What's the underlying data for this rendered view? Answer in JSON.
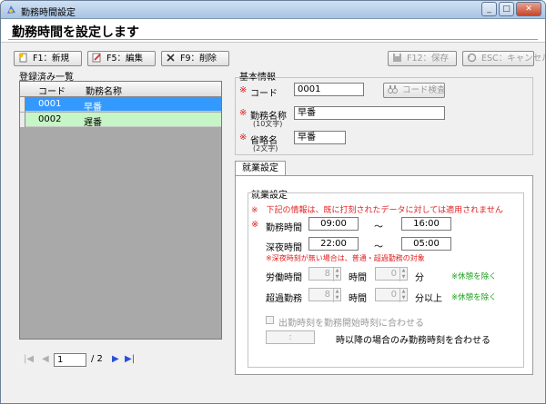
{
  "window": {
    "title": "勤務時間設定",
    "minimize": "_",
    "maximize": "□",
    "close": "✕"
  },
  "page": {
    "title": "勤務時間を設定します"
  },
  "toolbar": {
    "new_label": "F1：新規",
    "edit_label": "F5：編集",
    "delete_label": "F9：削除",
    "save_label": "F12：保存",
    "cancel_label": "ESC：キャンセル"
  },
  "list": {
    "title": "登録済み一覧",
    "columns": {
      "code": "コード",
      "name": "勤務名称"
    },
    "rows": [
      {
        "code": "0001",
        "name": "早番"
      },
      {
        "code": "0002",
        "name": "遅番"
      }
    ],
    "selected_index": 0
  },
  "pager": {
    "current": "1",
    "total": "/ 2"
  },
  "basic": {
    "title": "基本情報",
    "code_label": "コード",
    "code_value": "0001",
    "code_search": "コード検査",
    "name_label": "勤務名称",
    "name_note": "(10文字)",
    "name_value": "早番",
    "short_label": "省略名",
    "short_note": "(2文字)",
    "short_value": "早番",
    "required_mark": "※"
  },
  "work": {
    "tab_label": "就業設定",
    "section_title": "就業設定",
    "warning": "※　下記の情報は、既に打刻されたデータに対しては適用されません",
    "work_time_label": "勤務時間",
    "work_start": "09:00",
    "work_end": "16:00",
    "tilde": "～",
    "night_label": "深夜時間",
    "night_start": "22:00",
    "night_end": "05:00",
    "night_note": "※深夜時刻が無い場合は、普通・超過勤務の対象",
    "labor_label": "労働時間",
    "labor_hours": "8",
    "labor_hour_unit": "時間",
    "labor_minutes": "0",
    "labor_min_unit": "分",
    "labor_note": "※休憩を除く",
    "overtime_label": "超過勤務",
    "overtime_hours": "8",
    "overtime_hour_unit": "時間",
    "overtime_minutes": "0",
    "overtime_min_unit": "分以上",
    "overtime_note": "※休憩を除く",
    "align_checkbox_label": "出勤時刻を勤務開始時刻に合わせる",
    "align_time_value": ":",
    "align_suffix": "時以降の場合のみ勤務時刻を合わせる"
  },
  "colors": {
    "selected_row": "#3399ff",
    "alt_row": "#c6f5c6",
    "required": "#e02020",
    "note_green": "#18a018"
  }
}
